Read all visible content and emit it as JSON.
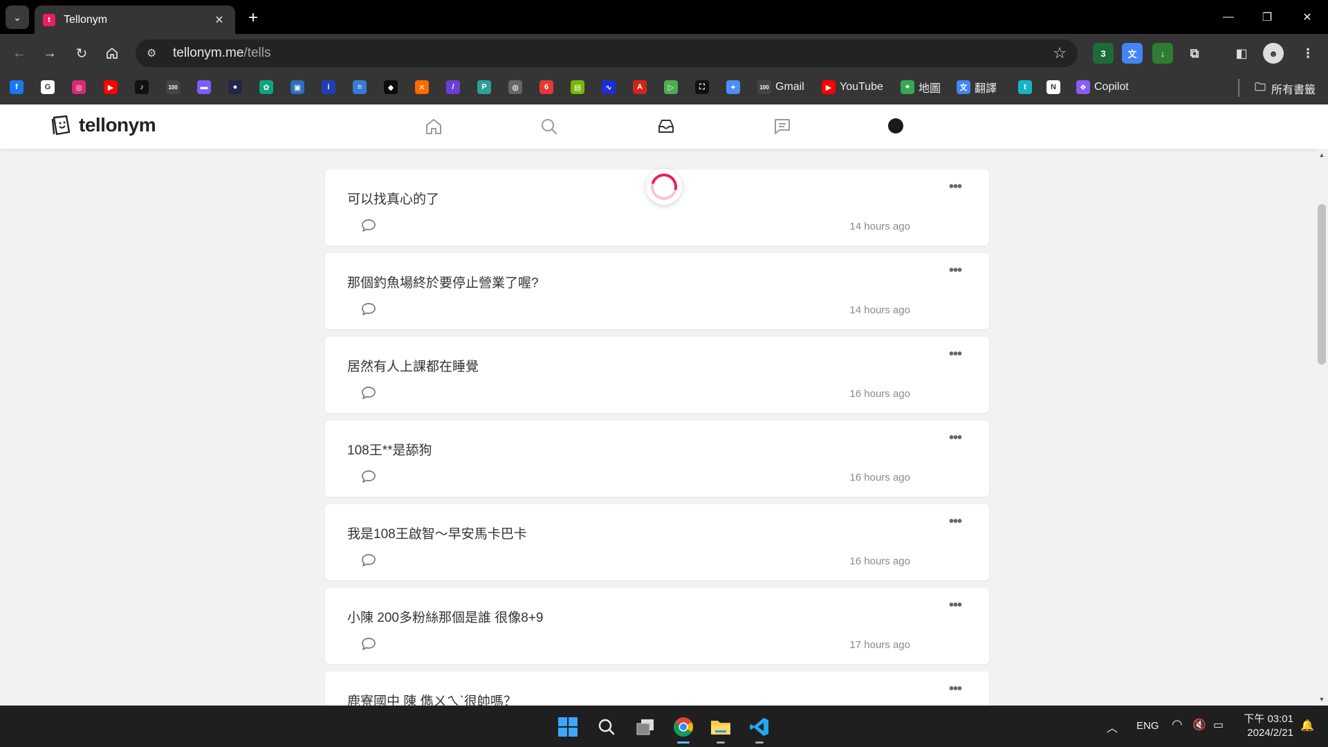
{
  "browser": {
    "tab_title": "Tellonym",
    "url_host": "tellonym.me",
    "url_path": "/tells",
    "extension_badge": "3",
    "bookmarks": [
      {
        "name": "facebook",
        "label": "",
        "color": "#1877f2",
        "glyph": "f"
      },
      {
        "name": "google",
        "label": "",
        "color": "#ffffff",
        "glyph": "G"
      },
      {
        "name": "instagram",
        "label": "",
        "color": "#d62976",
        "glyph": "◎"
      },
      {
        "name": "youtube",
        "label": "",
        "color": "#ff0000",
        "glyph": "▶"
      },
      {
        "name": "tiktok",
        "label": "",
        "color": "#111111",
        "glyph": "♪"
      },
      {
        "name": "hundred",
        "label": "",
        "color": "#444444",
        "glyph": "100"
      },
      {
        "name": "gradient-bar",
        "label": "",
        "color": "#7a5cff",
        "glyph": "▬"
      },
      {
        "name": "dark-circle",
        "label": "",
        "color": "#22264a",
        "glyph": "●"
      },
      {
        "name": "openai",
        "label": "",
        "color": "#10a37f",
        "glyph": "✿"
      },
      {
        "name": "square-app",
        "label": "",
        "color": "#2c6fbf",
        "glyph": "▣"
      },
      {
        "name": "i-app",
        "label": "",
        "color": "#1d3fb3",
        "glyph": "i"
      },
      {
        "name": "stack-app",
        "label": "",
        "color": "#3a7bd5",
        "glyph": "≡"
      },
      {
        "name": "diamond-app",
        "label": "",
        "color": "#0b0b0b",
        "glyph": "◆"
      },
      {
        "name": "orange-app",
        "label": "",
        "color": "#ff6a00",
        "glyph": "✕"
      },
      {
        "name": "purple-app",
        "label": "",
        "color": "#6b3fd1",
        "glyph": "/"
      },
      {
        "name": "teal-app",
        "label": "",
        "color": "#2aa198",
        "glyph": "P"
      },
      {
        "name": "globe",
        "label": "",
        "color": "#666666",
        "glyph": "◍"
      },
      {
        "name": "red-app",
        "label": "",
        "color": "#e53935",
        "glyph": "6"
      },
      {
        "name": "nvidia",
        "label": "",
        "color": "#76b900",
        "glyph": "▤"
      },
      {
        "name": "wave-app",
        "label": "",
        "color": "#1b2fd6",
        "glyph": "∿"
      },
      {
        "name": "acrobat",
        "label": "",
        "color": "#d3241b",
        "glyph": "A"
      },
      {
        "name": "play-app",
        "label": "",
        "color": "#4caf50",
        "glyph": "▷"
      },
      {
        "name": "scan-app",
        "label": "",
        "color": "#111111",
        "glyph": "⛶"
      },
      {
        "name": "gemini",
        "label": "",
        "color": "#4c8df6",
        "glyph": "✦"
      },
      {
        "name": "gmail",
        "label": "Gmail",
        "color": "#444444",
        "glyph": "100"
      },
      {
        "name": "youtube-labeled",
        "label": "YouTube",
        "color": "#ff0000",
        "glyph": "▶"
      },
      {
        "name": "maps",
        "label": "地圖",
        "color": "#34a853",
        "glyph": "⌖"
      },
      {
        "name": "translate",
        "label": "翻譯",
        "color": "#4285f4",
        "glyph": "文"
      },
      {
        "name": "t-app",
        "label": "",
        "color": "#17b4c6",
        "glyph": "t"
      },
      {
        "name": "notion",
        "label": "",
        "color": "#ffffff",
        "glyph": "N"
      },
      {
        "name": "copilot",
        "label": "Copilot",
        "color": "#8a5cf6",
        "glyph": "❖"
      }
    ],
    "all_bookmarks_label": "所有書籤"
  },
  "app": {
    "logo_text": "tellonym",
    "accent_color": "#ea1f5d"
  },
  "tells": [
    {
      "text": "可以找真心的了",
      "time": "14 hours ago"
    },
    {
      "text": "那個釣魚場終於要停止營業了喔?",
      "time": "14 hours ago"
    },
    {
      "text": "居然有人上課都在睡覺",
      "time": "16 hours ago"
    },
    {
      "text": "108王**是舔狗",
      "time": "16 hours ago"
    },
    {
      "text": "我是108王啟智～早安馬卡巴卡",
      "time": "16 hours ago"
    },
    {
      "text": "小陳 200多粉絲那個是誰 很像8+9",
      "time": "17 hours ago"
    },
    {
      "text": "鹿寮國中 陳 儁ㄨㄟˋ很帥嗎？",
      "time": ""
    }
  ],
  "taskbar": {
    "language": "ENG",
    "time": "下午 03:01",
    "date": "2024/2/21"
  }
}
